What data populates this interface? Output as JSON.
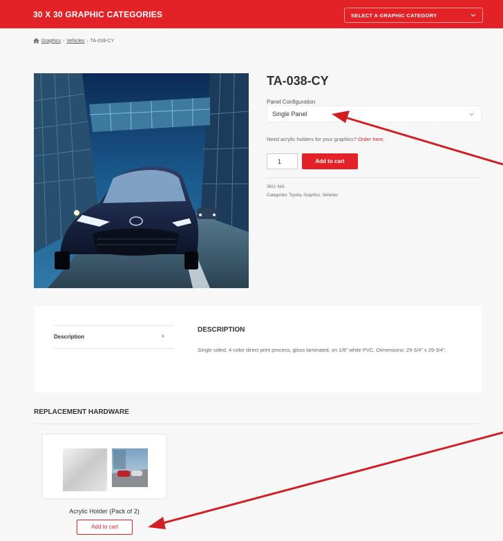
{
  "header": {
    "title": "30 X 30 GRAPHIC CATEGORIES",
    "category_select": "SELECT A GRAPHIC CATEGORY"
  },
  "breadcrumb": {
    "items": [
      "Graphics",
      "Vehicles",
      "TA-038-CY"
    ],
    "separator": "›"
  },
  "product": {
    "title": "TA-038-CY",
    "config_label": "Panel Configuration",
    "config_value": "Single Panel",
    "acrylic_text": "Need acrylic holders for your graphics?",
    "acrylic_link": "Order here.",
    "quantity": "1",
    "add_to_cart": "Add to cart",
    "sku": "SKU: N/A",
    "categories_label": "Categories:",
    "categories": "Toyota, Graphics, Vehicles"
  },
  "description": {
    "tab_label": "Description",
    "tab_arrow": "›",
    "heading": "DESCRIPTION",
    "body": "Single sided, 4-color direct print process, gloss laminated, on 1/8\" white PVC. Dimensions: 29-3/4\" x 29-3/4\"."
  },
  "replacement": {
    "heading": "REPLACEMENT HARDWARE",
    "item_title": "Acrylic Holder (Pack of 2)",
    "add_to_cart": "Add to cart"
  },
  "colors": {
    "brand_red": "#e22227",
    "page_bg": "#f7f7f7"
  },
  "icons": [
    "home-icon",
    "chevron-down-icon",
    "chevron-right-icon",
    "annotation-arrow"
  ]
}
